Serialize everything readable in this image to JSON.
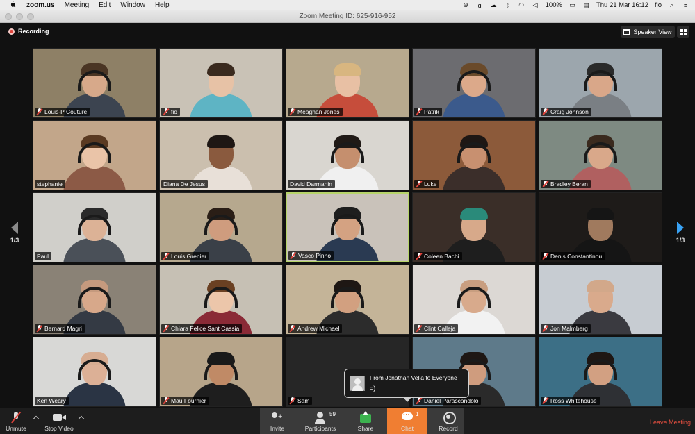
{
  "menubar": {
    "apple": "",
    "items": [
      "zoom.us",
      "Meeting",
      "Edit",
      "Window",
      "Help"
    ],
    "battery": "100%",
    "clock": "Thu 21 Mar  16:12",
    "user": "fio"
  },
  "window": {
    "title": "Zoom Meeting ID: 625-916-952"
  },
  "top": {
    "recording": "Recording",
    "speaker_view": "Speaker View"
  },
  "pager": {
    "left": "1/3",
    "right": "1/3"
  },
  "participants": [
    {
      "name": "Louis-P Couture",
      "muted": true,
      "wall": "#8e8066",
      "skin": "#d7a98a",
      "shirt": "#3c4450",
      "hair": "#4a3524",
      "phones": true
    },
    {
      "name": "fio",
      "muted": true,
      "wall": "#c9c2b6",
      "skin": "#e7c2a6",
      "shirt": "#5eb4c4",
      "hair": "#3a2a1e",
      "phones": false
    },
    {
      "name": "Meaghan Jones",
      "muted": true,
      "wall": "#b7a98e",
      "skin": "#e8c0a4",
      "shirt": "#c64d3b",
      "hair": "#d8b680",
      "phones": false
    },
    {
      "name": "Patrik",
      "muted": true,
      "wall": "#6c6c70",
      "skin": "#dca98a",
      "shirt": "#3b5a8c",
      "hair": "#6a4a2a",
      "phones": true
    },
    {
      "name": "Craig Johnson",
      "muted": true,
      "wall": "#9ca6ad",
      "skin": "#d9a789",
      "shirt": "#7a7f84",
      "hair": "#2a2a2a",
      "phones": true
    },
    {
      "name": "stephanie",
      "muted": false,
      "wall": "#c2a68a",
      "skin": "#eac4a8",
      "shirt": "#8c5a46",
      "hair": "#5a3a22",
      "phones": true
    },
    {
      "name": "Diana De Jesus",
      "muted": false,
      "wall": "#cbbfae",
      "skin": "#8a5a3e",
      "shirt": "#e8e0d8",
      "hair": "#1e1714",
      "phones": false
    },
    {
      "name": "David Darmanin",
      "muted": false,
      "wall": "#d9d6d0",
      "skin": "#c58f6e",
      "shirt": "#f0f0f0",
      "hair": "#201a16",
      "phones": true
    },
    {
      "name": "Luke",
      "muted": true,
      "wall": "#8c5a3a",
      "skin": "#c89070",
      "shirt": "#3b2e2a",
      "hair": "#1e1714",
      "phones": true
    },
    {
      "name": "Bradley Beran",
      "muted": true,
      "wall": "#7e8a82",
      "skin": "#d9a88a",
      "shirt": "#b06060",
      "hair": "#3a2a1e",
      "phones": true
    },
    {
      "name": "Paul",
      "muted": false,
      "wall": "#d0cfca",
      "skin": "#dcb296",
      "shirt": "#4a5058",
      "hair": "#2a2a2a",
      "phones": true
    },
    {
      "name": "Louis Grenier",
      "muted": true,
      "wall": "#b6a88e",
      "skin": "#cf9c7e",
      "shirt": "#3a4048",
      "hair": "#2a1e16",
      "phones": true
    },
    {
      "name": "Vasco Pinho",
      "muted": true,
      "wall": "#c9c2ba",
      "skin": "#d4a282",
      "shirt": "#2a3a52",
      "hair": "#1e1e1e",
      "phones": true
    },
    {
      "name": "Coleen Bachi",
      "muted": true,
      "wall": "#3a2e28",
      "skin": "#d7a98a",
      "shirt": "#1e1e1e",
      "hair": "#2a8a7a",
      "phones": false
    },
    {
      "name": "Denis Constantinou",
      "muted": true,
      "wall": "#1e1b19",
      "skin": "#a07a5e",
      "shirt": "#151515",
      "hair": "#151515",
      "phones": false
    },
    {
      "name": "Bernard Magri",
      "muted": true,
      "wall": "#8a8276",
      "skin": "#d7a88a",
      "shirt": "#343a44",
      "hair": "#c59a7e",
      "phones": true
    },
    {
      "name": "Chiara Felice Sant Cassia",
      "muted": true,
      "wall": "#c6c0b4",
      "skin": "#ecc6aa",
      "shirt": "#8a2a36",
      "hair": "#6a4022",
      "phones": true
    },
    {
      "name": "Andrew Michael",
      "muted": true,
      "wall": "#c4b498",
      "skin": "#d2a080",
      "shirt": "#2c2c2c",
      "hair": "#1e1714",
      "phones": true
    },
    {
      "name": "Clint Calleja",
      "muted": true,
      "wall": "#dcd8d4",
      "skin": "#d8aa8c",
      "shirt": "#f2f2f2",
      "hair": "#c89e80",
      "phones": true
    },
    {
      "name": "Jon Malmberg",
      "muted": true,
      "wall": "#c7ccd2",
      "skin": "#d9aa8c",
      "shirt": "#3a3a40",
      "hair": "#d2a88a",
      "phones": false
    },
    {
      "name": "Ken Weary",
      "muted": false,
      "wall": "#d8d8d6",
      "skin": "#dcb096",
      "shirt": "#2a3444",
      "hair": "#d7ad92",
      "phones": true
    },
    {
      "name": "Mau Fournier",
      "muted": true,
      "wall": "#b7a58a",
      "skin": "#c08a66",
      "shirt": "#1e1e1e",
      "hair": "#1a1a1a",
      "phones": true
    },
    {
      "name": "Sam",
      "muted": true,
      "wall": "#262626",
      "skin": "#262626",
      "shirt": "#262626",
      "hair": "#262626",
      "phones": false,
      "empty": true
    },
    {
      "name": "Daniel Parascandolo",
      "muted": true,
      "wall": "#5e7a8a",
      "skin": "#cf9c7e",
      "shirt": "#2a2a2a",
      "hair": "#1e1714",
      "phones": true
    },
    {
      "name": "Ross Whitehouse",
      "muted": true,
      "wall": "#3c6f86",
      "skin": "#d2a082",
      "shirt": "#2e3034",
      "hair": "#1e1714",
      "phones": true
    }
  ],
  "chat_toast": {
    "from": "From Jonathan Vella to Everyone",
    "message": "=)"
  },
  "toolbar": {
    "unmute": "Unmute",
    "stop_video": "Stop Video",
    "invite": "Invite",
    "participants": "Participants",
    "participant_count": "59",
    "share": "Share",
    "chat": "Chat",
    "chat_count": "1",
    "record": "Record",
    "leave": "Leave Meeting"
  },
  "colors": {
    "accent": "#f07e32",
    "leave": "#e44e3f",
    "share": "#3cb24f",
    "active_speaker": "#b7d46a"
  }
}
